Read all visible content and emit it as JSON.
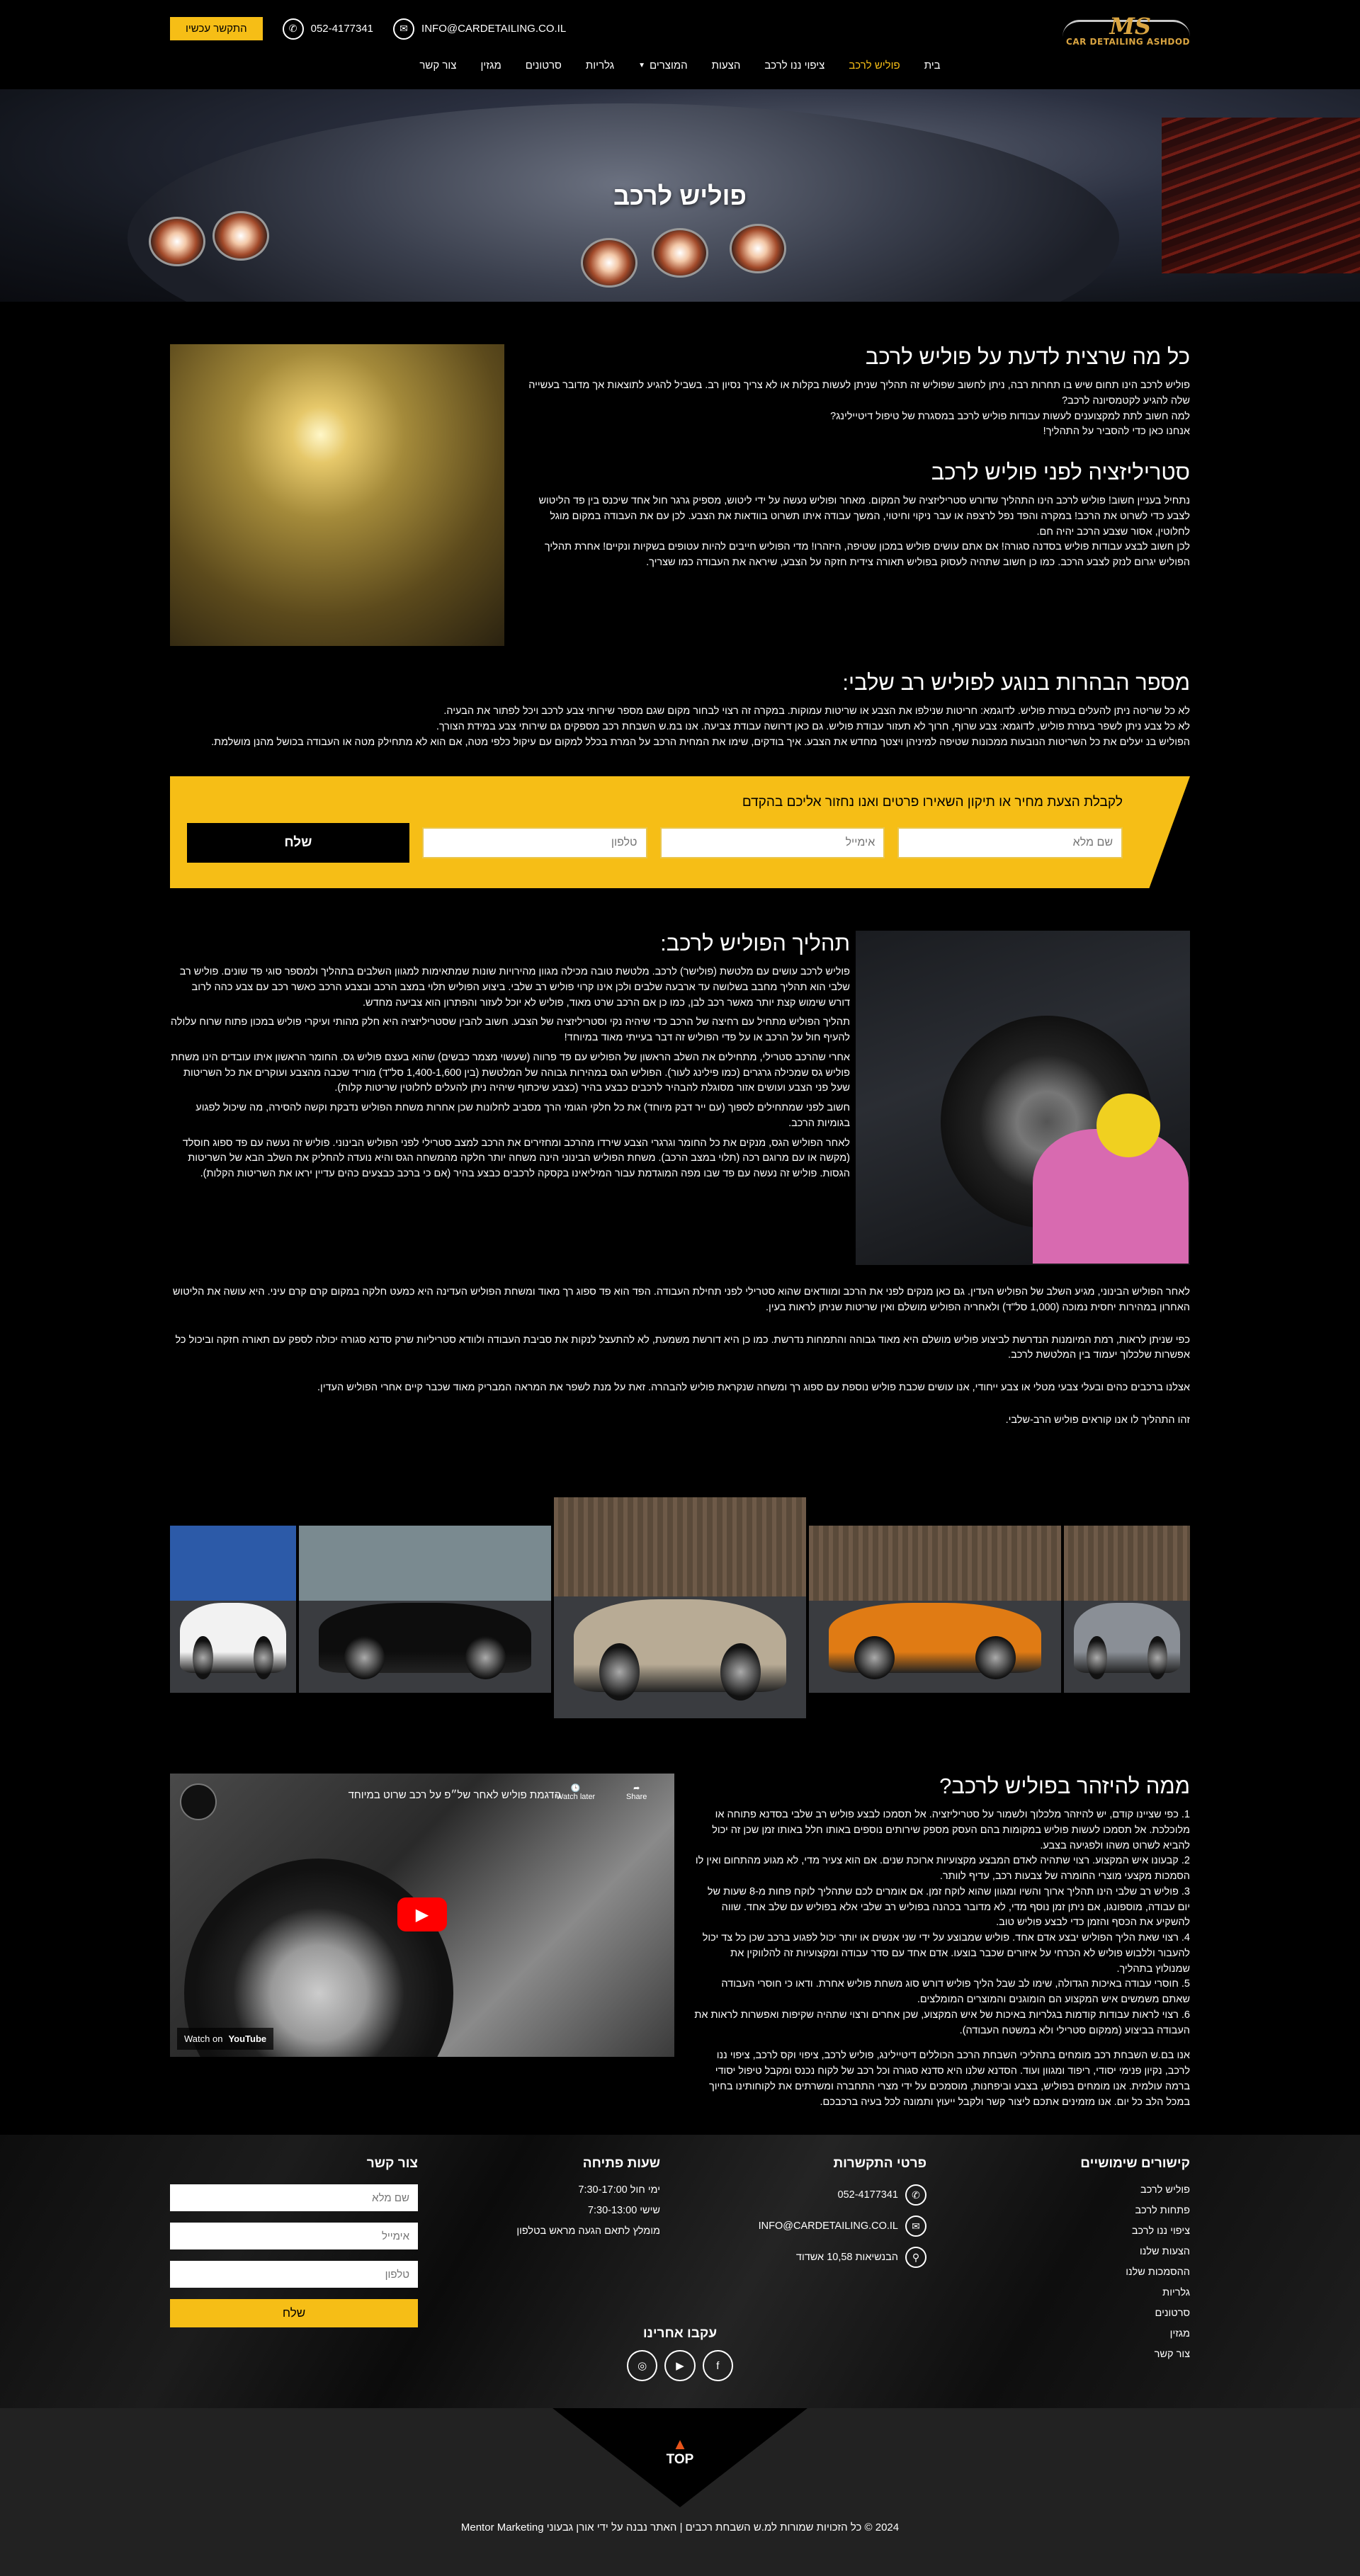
{
  "header": {
    "logo_text": "MS",
    "logo_tagline": "CAR DETAILING ASHDOD",
    "cta": "התקשר עכשיו",
    "phone": "052-4177341",
    "email": "INFO@CARDETAILING.CO.IL",
    "nav": [
      {
        "label": "בית",
        "active": false
      },
      {
        "label": "פוליש לרכב",
        "active": true
      },
      {
        "label": "ציפוי ננו לרכב",
        "active": false
      },
      {
        "label": "הצעות",
        "active": false
      },
      {
        "label": "המוצרים",
        "active": false,
        "dropdown": true
      },
      {
        "label": "גלריות",
        "active": false
      },
      {
        "label": "סרטונים",
        "active": false
      },
      {
        "label": "מגזין",
        "active": false
      },
      {
        "label": "צור קשר",
        "active": false
      }
    ]
  },
  "hero": {
    "title": "פוליש לרכב"
  },
  "section1": {
    "title": "כל מה שרצית לדעת על פוליש לרכב",
    "intro": [
      "פוליש לרכב הינו תחום שיש בו תחרות רבה, ניתן לחשוב שפוליש זה תהליך שניתן לעשות בקלות או לא צריך נסיון רב. בשביל להגיע לתוצאות אך מדובר בעשייה שלה להגיע לקטמסיונה לרכב?",
      "למה חשוב לתת למקצוענים לעשות עבודות פוליש לרכב במסגרת של טיפול דיטיילינג?",
      "אנחנו כאן כדי להסביר על התהליך!"
    ],
    "subtitle": "סטריליזציה לפני פוליש לרכב",
    "body": [
      "נתחיל בעניין חשוב! פוליש לרכב הינו התהליך שדורש סטריליזציה של המקום. מאחר ופוליש נעשה על ידי ליטוש, מספיק גרגר חול אחד שיכנס בין פד הליטוש לצבע כדי לשרוט את הרכב! במקרה והפד נפל לרצפה או עבר ניקוי וחיטוי, המשך עבודה איתו תשרוט בוודאות את הצבע. לכן עם את העבודה במקום מוגל לחלוטין, אסור שצבע הרכב יהיה חם.",
      "לכן חשוב לבצע עבודות פוליש בסדנה סגורה! אם אתם עושים פוליש במכון שטיפה, היזהרו! מדי הפוליש חייבים להיות עטופים בשקיות ונקיים! אחרת תהליך הפוליש יגרום לנזק לצבע הרכב. כמו כן חשוב שתהיה לעסוק בפוליש תאורה צידית חזקה על הצבע, שיראה את העבודה כמו שצריך."
    ]
  },
  "section2": {
    "title": "מספר הבהרות בנוגע לפוליש רב שלבי:",
    "body": [
      "לא כל שריטה ניתן להעלים בעזרת פוליש. לדוגמא: חריטות שנילפו את הצבע או שריטות עמוקות. במקרה זה רצוי לבחור מקום שגם מספר שירותי צבע לרכב ויכל לפתור את הבעיה.",
      "לא כל צבע ניתן לשפר בעזרת פוליש, לדוגמא: צבע שרוף, חרוך לא תעזור עבודת פוליש. גם כאן דרושה עבודת צביעה. אנו במ.ש השבחת רכב מספקים גם שירותי צבע במידת הצורך.",
      "הפוליש בנ יעלים את כל השריטות הנובעות ממכונות שטיפה למיניהן ויצטך מחדש את הצבע. איך בודקים, שימו את המחית הרכב על המרת בכלל למקום עם עיקול כלפי מטה, אם הוא לא מתחילק מטה או העבודה בכושל מהנן מושלמת."
    ]
  },
  "quote_form": {
    "title": "לקבלת הצעת מחיר או תיקון השאירו פרטים ואנו נחזור אליכם בהקדם",
    "name_placeholder": "שם מלא",
    "email_placeholder": "אימייל",
    "phone_placeholder": "טלפון",
    "submit": "שלח"
  },
  "section3": {
    "title": "תהליך הפוליש לרכב:",
    "body": [
      "פוליש לרכב עושים עם מלטשת (פולישר) לרכב. מלטשת טובה מכילה מגוון מהירויות שונות שמתאימות למגוון השלבים בתהליך ולמספר סוגי פד שונים. פוליש רב שלבי הוא תהליך מחבב בשלושה עד ארבעה שלבים ולכן אינו קרוי פוליש רב שלבי. ביצוע הפוליש תלוי במצב הרכב ובצבע הרכב כאשר רכב עם צבע כהה לרוב דורש שימוש קצת יותר מאשר רכב לבן, כמו כן אם הרכב שרט מאוד, פוליש לא יוכל לעזור והפתרון הוא צביעה מחדש.",
      "תהליך הפוליש מתחיל עם רחיצה של הרכב כדי שיהיה נקי וסטריליזציה של הצבע. חשוב להבין שסטריליזציה היא חלק מהותי ועיקרי פוליש במכון פתוח שרוח עלולה להעיף חול על הרכב או על פדי הפוליש זה דבר בעייתי מאוד במיוחד!",
      "אחרי שהרכב סטרילי, מתחילים את השלב הראשון של הפוליש עם פד פרווה (שעשוי מצמר כבשים) שהוא בעצם פוליש גס. החומר הראשון איתו עובדים הינו משחת פוליש גס שמכילה גרגרים (כמו פילינג לעור). הפוליש הגס במהירות גבוהה של המלטשת (בין 1,400-1,600 סל\"ד) מוריד שכבה מהצבע ועוקרים את כל השריטות שעל פני הצבע ועושים אזור מסוגלת להבהיר לרכבים כבצע בהיר (כצבע שיכתוף שיהיה ניתן להעלים לחלוטין שריטות קלות).",
      "חשוב לפני שמתחילים לספוך (עם ייר דבק מיוחד) את כל חלקי הגומי הרך מסביב לחלונות שכן אחרות משחת הפוליש נדבקת וקשה להסירה, מה שיכול לפגוע בגומיות הרכב.",
      "לאחר הפוליש הגס, מנקים את כל החומר וגרגרי הצבע שירדו מהרכב ומחזירים את הרכב למצב סטרילי לפני הפוליש הבינוני. פוליש זה נעשה עם פד ספוג חוסלד (מקשה או עם מרוגם רכה (תלוי במצב הרכב). משחת הפוליש הבינוני הינה משחה יותר חלקה מהמשחה הגס והיא נועדה להחליק את השלב הבא של השריטות הגסות. פוליש זה נעשה עם פד שבו מפה המוגדמת עבור המיליאינו בקסקה לרכבים כבצע בהיר (אם כי ברכב כבצעים כהים עדיין יראו את השריטות הקלות)."
    ],
    "after": [
      "לאחר הפוליש הבינוני, מגיע השלב של הפוליש העדין. גם כאן מנקים לפני את הרכב ומוודאים שהוא סטרילי לפני תחילת העבודה. הפד הוא פד ספוג רך מאוד ומשחת הפוליש העדינה היא כמעט חלקה במקום קרם קרם עיני. היא עושה את הליטוש האחרון במהירות יחסית נמוכה (1,000 סל\"ד) ולאחריה הפוליש מושלם ואין שריטות שניתן לראות בעין.",
      "כפי שניתן לראות, רמת המיומנות הנדרשת לביצוע פוליש מושלם היא מאוד גבוהה והתמחות נדרשת. כמו כן היא דורשת משמעת, לא להתעצל לנקות את סביבת העבודה ולוודא סטריליות שרק סדנא סגורה יכולה לספק עם תאורה חזקה וביכול כל אפשרות שלכלוך יעמוד בין המלטשת לרכב.",
      "אצלנו ברכבים כהים ובעלי צבעי מטלי או צבע ייחודי, אנו עושים שכבת פוליש נוספת עם ספוג רך ומשחה שנקראת פוליש להבהרה. זאת על מנת לשפר את המראה המבריק מאוד שכבר קיים אחרי הפוליש העדין.",
      "זהו התהליך לו אנו קוראים פוליש הרב-שלבי."
    ]
  },
  "gallery": {
    "cars": [
      {
        "color": "#f2f2f2"
      },
      {
        "color": "#0d0d0d"
      },
      {
        "color": "#b8ab95"
      },
      {
        "color": "#e07b14"
      },
      {
        "color": "#8a8f96"
      }
    ]
  },
  "section4": {
    "title": "ממה להיזהר בפוליש לרכב?",
    "items": [
      "1. כפי שציינו קודם, יש להיזהר מלכלוך ולשמור על סטריליזציה. אל תסמכו לבצע פוליש רב שלבי בסדנא פתוחה או מלוכלכת. אל תסמכו לעשות פוליש במקומות בהם העסק מספק שירותים נוספים באותו חלל באותו זמן שכן זה יכול להביא לשרוט משהו ולפגיעה בצבע.",
      "2. קבעונו איש המקצוע. רצוי שתהיה לאדם המבצע מקצועיות ארוכת שנים. אם הוא צעיר מדי, לא מגוע מהתחום ואין לו הסמכות מקצעי מוצרי החומרה של צבעות רכב, עדיף לוותר.",
      "3. פוליש רב שלבי הינו תהליך ארוך והשיו ומגוון שהוא לוקח זמן. אם אומרים לכם שתהליך לוקח פחות מ-8 שעות של יום עבודה, מוספונגו, אם ניתן זמן נוסף מדי, לא מדובר בכהנה בפוליש רב שלבי אלא בפוליש עם שלב אחד. שווה להשקיע את הכסף והזמן כדי לבצע פוליש טוב.",
      "4. רצוי שאת הליך הפוליש יבצע אדם אחד. פוליש שמבוצע על ידי שני אנשים או יותר יכול לפגוע ברכב שכן כל צד יכול להעבור וללבוש פוליש לא הכרחי על איזורים שכבר בוצעו. אדם אחד עם סדר עבודה ומקצועיות זה להלווקין את שמנולוץ בתהליך.",
      "5. חוסרי עבודה באיכות הגדולה, שימו לב שבל הליך פוליש דורש סוג משחת פוליש אחרת. ודאו כי חוסרי העבודה שאתם משמשים איש המקצוע הם הומוגנים והמוצרים המומלצים.",
      "6. רצוי לראות עבודות קודמות בגלריות באיכות של איש המקצוע, שכן אחרים ורצוי שתהיה שקיפות ואפשרות לראות את העבודה בביצוע (ממקום סטרילי ולא במשטח העבודה)."
    ],
    "closing": "אנו בם.ש השבחת רכב מומחים בתהליכי השבחת הרכב הכוללים דיטיילינג, פוליש לרכב, ציפוי וקס לרכב, ציפוי ננו לרכב, נקיון פנימי יסודי, ריפוד ומגוון ועוד. הסדנא שלנו היא סדנא סגורה וכל רכב של לקוח נכנס ומקבל טיפול יסודי ברמה עולמית. אנו מומחים בפוליש, בצבע וביפחנות, מוסמכים על ידי מצרי התחברה ומשרתים את לקוחותינו בחיוך במכל הלב כל יום. אנו מזמינים אתכם ליצור קשר ולקבל ייעוץ ותמונה לכל בעיה ברכבכם.",
    "video": {
      "title": "הדגמת פוליש לאחר של״פ על רכב שרוט במיוחד",
      "watch_later": "Watch later",
      "share": "Share",
      "watch_on": "Watch on",
      "youtube": "YouTube"
    }
  },
  "footer": {
    "links_title": "קישורים שימושיים",
    "links": [
      "פוליש לרכב",
      "פתחות לרכב",
      "ציפוי ננו לרכב",
      "הצעות שלנו",
      "ההסמכות שלנו",
      "גלריות",
      "סרטונים",
      "מגזין",
      "צור קשר"
    ],
    "contact_title": "פרטי התקשרות",
    "phone": "052-4177341",
    "email": "INFO@CARDETAILING.CO.IL",
    "address": "הבנשיאות 10,58 אשדוד",
    "hours_title": "שעות פתיחה",
    "hours": [
      "ימי חול 7:30-17:00",
      "שישי 7:30-13:00",
      "מומלץ לתאם הגעה מראש בטלפון"
    ],
    "form_title": "צור קשר",
    "name_placeholder": "שם מלא",
    "email_placeholder": "אימייל",
    "phone_placeholder": "טלפון",
    "submit": "שלח",
    "follow_title": "עקבו אחרינו",
    "top": "TOP",
    "copyright": "2024 © כל הזכויות שמורות למ.ש השבחת רכבים | האתר נבנה על ידי אורן גבעוני Mentor Marketing"
  },
  "colors": {
    "accent": "#f6be16",
    "background": "#000000",
    "top_arrow": "#e8541a"
  }
}
